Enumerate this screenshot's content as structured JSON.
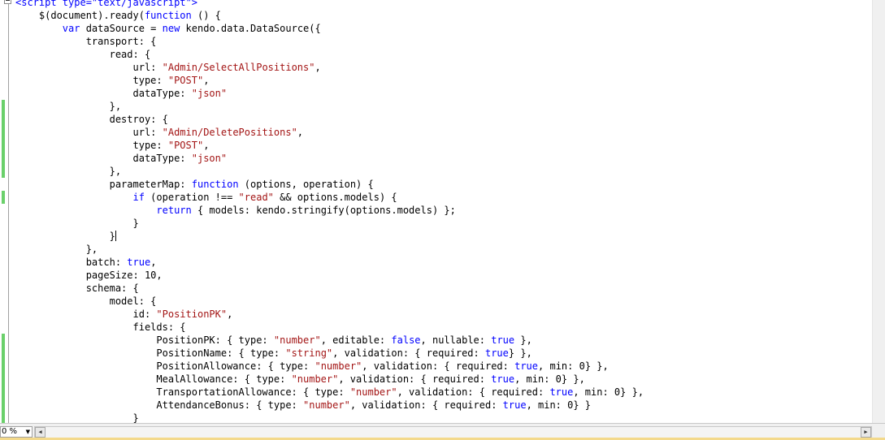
{
  "editor": {
    "language": "javascript",
    "lines": [
      [
        [
          "k",
          "<script type=\"text/javascript\">"
        ]
      ],
      [
        [
          "t",
          "    $(document).ready("
        ],
        [
          "k",
          "function"
        ],
        [
          "t",
          " () {"
        ]
      ],
      [
        [
          "t",
          "        "
        ],
        [
          "k",
          "var"
        ],
        [
          "t",
          " dataSource = "
        ],
        [
          "k",
          "new"
        ],
        [
          "t",
          " kendo.data.DataSource({"
        ]
      ],
      [
        [
          "t",
          "            transport: {"
        ]
      ],
      [
        [
          "t",
          "                read: {"
        ]
      ],
      [
        [
          "t",
          "                    url: "
        ],
        [
          "s",
          "\"Admin/SelectAllPositions\""
        ],
        [
          "t",
          ","
        ]
      ],
      [
        [
          "t",
          "                    type: "
        ],
        [
          "s",
          "\"POST\""
        ],
        [
          "t",
          ","
        ]
      ],
      [
        [
          "t",
          "                    dataType: "
        ],
        [
          "s",
          "\"json\""
        ]
      ],
      [
        [
          "t",
          "                },"
        ]
      ],
      [
        [
          "t",
          "                destroy: {"
        ]
      ],
      [
        [
          "t",
          "                    url: "
        ],
        [
          "s",
          "\"Admin/DeletePositions\""
        ],
        [
          "t",
          ","
        ]
      ],
      [
        [
          "t",
          "                    type: "
        ],
        [
          "s",
          "\"POST\""
        ],
        [
          "t",
          ","
        ]
      ],
      [
        [
          "t",
          "                    dataType: "
        ],
        [
          "s",
          "\"json\""
        ]
      ],
      [
        [
          "t",
          "                },"
        ]
      ],
      [
        [
          "t",
          "                parameterMap: "
        ],
        [
          "k",
          "function"
        ],
        [
          "t",
          " (options, operation) {"
        ]
      ],
      [
        [
          "t",
          "                    "
        ],
        [
          "k",
          "if"
        ],
        [
          "t",
          " (operation !== "
        ],
        [
          "s",
          "\"read\""
        ],
        [
          "t",
          " && options.models) {"
        ]
      ],
      [
        [
          "t",
          "                        "
        ],
        [
          "k",
          "return"
        ],
        [
          "t",
          " { models: kendo.stringify(options.models) };"
        ]
      ],
      [
        [
          "t",
          "                    }"
        ]
      ],
      [
        [
          "t",
          "                }"
        ],
        [
          "c",
          ""
        ]
      ],
      [
        [
          "t",
          "            },"
        ]
      ],
      [
        [
          "t",
          "            batch: "
        ],
        [
          "k",
          "true"
        ],
        [
          "t",
          ","
        ]
      ],
      [
        [
          "t",
          "            pageSize: 10,"
        ]
      ],
      [
        [
          "t",
          "            schema: {"
        ]
      ],
      [
        [
          "t",
          "                model: {"
        ]
      ],
      [
        [
          "t",
          "                    id: "
        ],
        [
          "s",
          "\"PositionPK\""
        ],
        [
          "t",
          ","
        ]
      ],
      [
        [
          "t",
          "                    fields: {"
        ]
      ],
      [
        [
          "t",
          "                        PositionPK: { type: "
        ],
        [
          "s",
          "\"number\""
        ],
        [
          "t",
          ", editable: "
        ],
        [
          "k",
          "false"
        ],
        [
          "t",
          ", nullable: "
        ],
        [
          "k",
          "true"
        ],
        [
          "t",
          " },"
        ]
      ],
      [
        [
          "t",
          "                        PositionName: { type: "
        ],
        [
          "s",
          "\"string\""
        ],
        [
          "t",
          ", validation: { required: "
        ],
        [
          "k",
          "true"
        ],
        [
          "t",
          "} },"
        ]
      ],
      [
        [
          "t",
          "                        PositionAllowance: { type: "
        ],
        [
          "s",
          "\"number\""
        ],
        [
          "t",
          ", validation: { required: "
        ],
        [
          "k",
          "true"
        ],
        [
          "t",
          ", min: 0} },"
        ]
      ],
      [
        [
          "t",
          "                        MealAllowance: { type: "
        ],
        [
          "s",
          "\"number\""
        ],
        [
          "t",
          ", validation: { required: "
        ],
        [
          "k",
          "true"
        ],
        [
          "t",
          ", min: 0} },"
        ]
      ],
      [
        [
          "t",
          "                        TransportationAllowance: { type: "
        ],
        [
          "s",
          "\"number\""
        ],
        [
          "t",
          ", validation: { required: "
        ],
        [
          "k",
          "true"
        ],
        [
          "t",
          ", min: 0} },"
        ]
      ],
      [
        [
          "t",
          "                        AttendanceBonus: { type: "
        ],
        [
          "s",
          "\"number\""
        ],
        [
          "t",
          ", validation: { required: "
        ],
        [
          "k",
          "true"
        ],
        [
          "t",
          ", min: 0} }"
        ]
      ],
      [
        [
          "t",
          "                    }"
        ]
      ]
    ],
    "changed_line_indices": [
      8,
      9,
      10,
      11,
      12,
      13,
      15,
      26,
      27,
      28,
      29,
      30,
      31,
      32
    ]
  },
  "statusbar": {
    "zoom_value": "0 %",
    "zoom_arrow_icon": "chevron-down-icon",
    "scroll_left_icon": "scroll-left-icon",
    "scroll_right_icon": "scroll-right-icon"
  },
  "colors": {
    "keyword": "#0000ff",
    "string": "#a31515",
    "text": "#000000",
    "change_marker": "#6bd06b",
    "statusbar_bg": "#f0f0f0"
  }
}
